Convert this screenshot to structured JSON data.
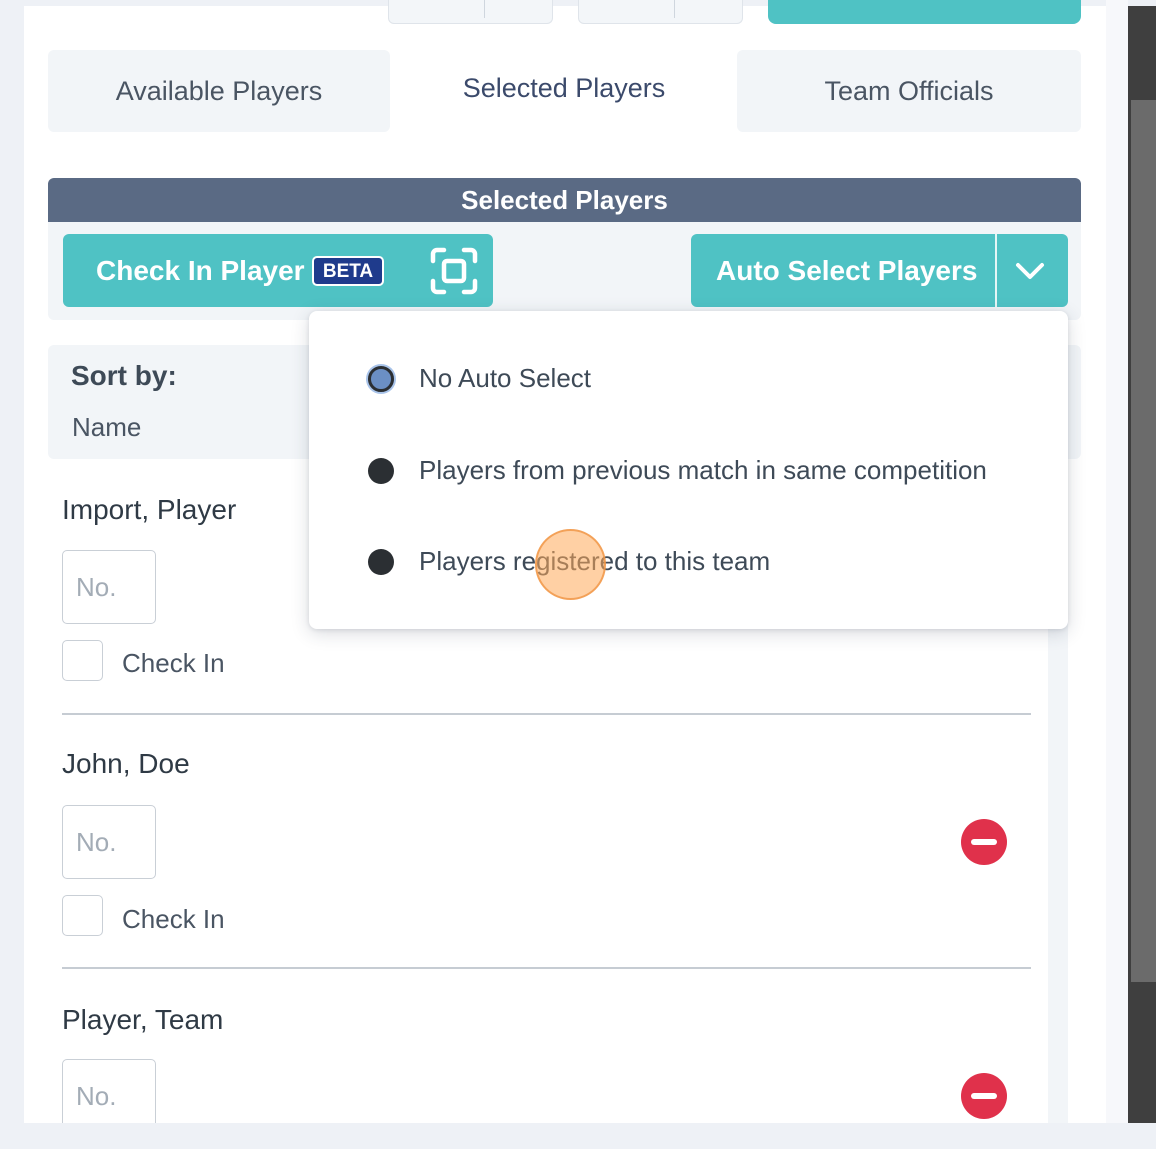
{
  "tabs": [
    {
      "label": "Available Players"
    },
    {
      "label": "Selected Players"
    },
    {
      "label": "Team Officials"
    }
  ],
  "section": {
    "title": "Selected Players"
  },
  "toolbar": {
    "checkin_label": "Check In Player",
    "beta_badge": "BETA",
    "auto_select_label": "Auto Select Players"
  },
  "sort": {
    "label": "Sort by:",
    "value": "Name"
  },
  "auto_select_menu": {
    "options": [
      {
        "label": "No Auto Select",
        "selected": true
      },
      {
        "label": "Players from previous match in same competition",
        "selected": false
      },
      {
        "label": "Players registered to this team",
        "selected": false
      }
    ]
  },
  "players": [
    {
      "name": "Import, Player",
      "number_placeholder": "No.",
      "checkin_label": "Check In"
    },
    {
      "name": "John, Doe",
      "number_placeholder": "No.",
      "checkin_label": "Check In"
    },
    {
      "name": "Player, Team",
      "number_placeholder": "No.",
      "checkin_label": "Check In"
    }
  ],
  "colors": {
    "accent": "#4fc2c4",
    "header": "#5a6a84",
    "beta": "#1f3b8c",
    "remove": "#e0314b"
  }
}
